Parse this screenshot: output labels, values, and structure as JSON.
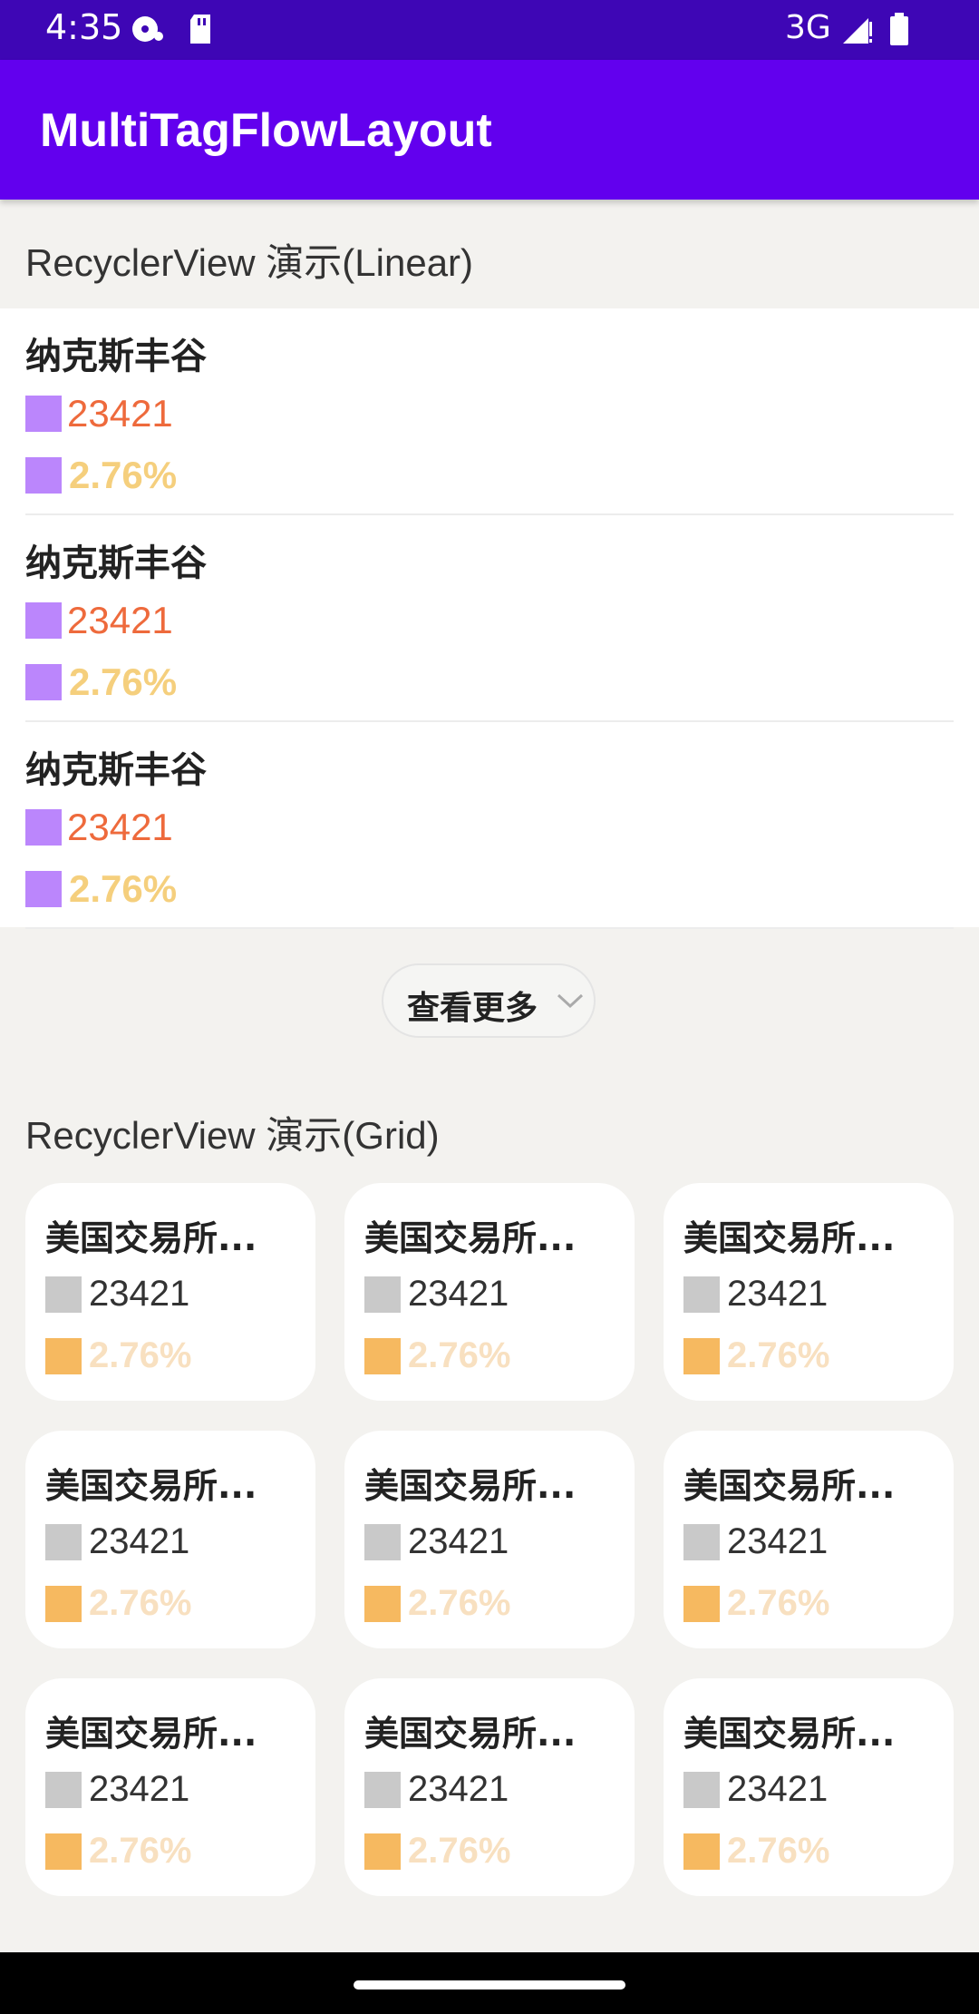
{
  "status_bar": {
    "time": "4:35",
    "network": "3G",
    "icons": [
      "sync-disc-icon",
      "sd-card-icon",
      "signal-icon",
      "battery-icon"
    ]
  },
  "app_bar": {
    "title": "MultiTagFlowLayout"
  },
  "linear_section": {
    "title": "RecyclerView 演示(Linear)",
    "items": [
      {
        "name": "纳克斯丰谷",
        "value": "23421",
        "percent": "2.76%"
      },
      {
        "name": "纳克斯丰谷",
        "value": "23421",
        "percent": "2.76%"
      },
      {
        "name": "纳克斯丰谷",
        "value": "23421",
        "percent": "2.76%"
      }
    ],
    "more_button": "查看更多"
  },
  "grid_section": {
    "title": "RecyclerView 演示(Grid)",
    "items": [
      {
        "name": "美国交易所...",
        "value": "23421",
        "percent": "2.76%"
      },
      {
        "name": "美国交易所...",
        "value": "23421",
        "percent": "2.76%"
      },
      {
        "name": "美国交易所...",
        "value": "23421",
        "percent": "2.76%"
      },
      {
        "name": "美国交易所...",
        "value": "23421",
        "percent": "2.76%"
      },
      {
        "name": "美国交易所...",
        "value": "23421",
        "percent": "2.76%"
      },
      {
        "name": "美国交易所...",
        "value": "23421",
        "percent": "2.76%"
      },
      {
        "name": "美国交易所...",
        "value": "23421",
        "percent": "2.76%"
      },
      {
        "name": "美国交易所...",
        "value": "23421",
        "percent": "2.76%"
      },
      {
        "name": "美国交易所...",
        "value": "23421",
        "percent": "2.76%"
      }
    ]
  },
  "colors": {
    "status_bar": "#3e06b5",
    "app_bar": "#6200ee",
    "tag_purple": "#bb86fc",
    "tag_grey": "#c9c9c9",
    "tag_orange": "#f6b960",
    "value_red": "#ee6a3c",
    "percent_yellow": "#f5cf7d"
  }
}
